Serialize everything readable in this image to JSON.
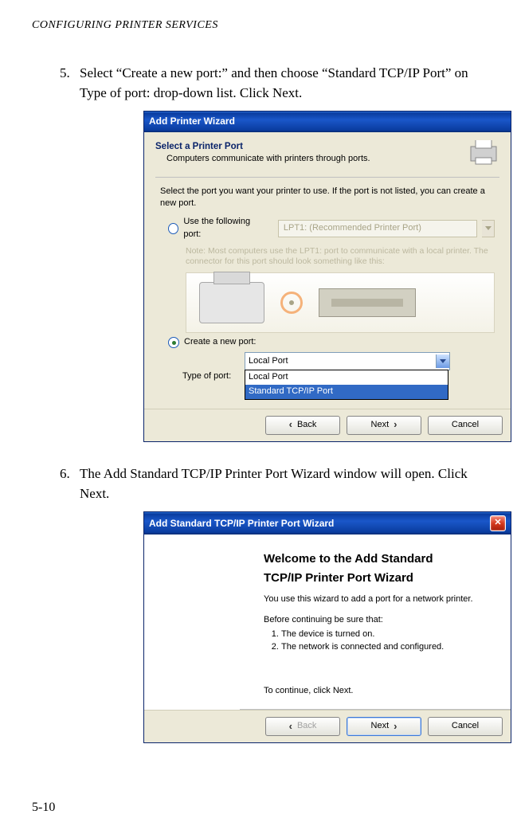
{
  "header": "CONFIGURING PRINTER SERVICES",
  "step5": {
    "num": "5.",
    "text": "Select “Create a new port:” and then choose “Standard TCP/IP Port” on Type of port: drop-down list. Click Next."
  },
  "step6": {
    "num": "6.",
    "text": "The Add Standard TCP/IP Printer Port Wizard window will open. Click Next."
  },
  "win1": {
    "title": "Add Printer Wizard",
    "heading": "Select a Printer Port",
    "desc": "Computers communicate with printers through ports.",
    "instr": "Select the port you want your printer to use.  If the port is not listed, you can create a new port.",
    "radio1": "Use the following port:",
    "lpt1": "LPT1: (Recommended Printer Port)",
    "note": "Note: Most computers use the LPT1: port to communicate with a local printer. The connector for this port should look something like this:",
    "radio2": "Create a new port:",
    "type_label": "Type of port:",
    "combo_selected": "Local Port",
    "combo_options": [
      "Local Port",
      "Standard TCP/IP Port"
    ],
    "back": "Back",
    "next": "Next",
    "cancel": "Cancel"
  },
  "win2": {
    "title": "Add Standard TCP/IP Printer Port Wizard",
    "heading1": "Welcome to the Add Standard",
    "heading2": "TCP/IP Printer Port Wizard",
    "lead": "You use this wizard to add a port for a network printer.",
    "before": "Before continuing be sure that:",
    "req1": "The device is turned on.",
    "req2": "The network is connected and configured.",
    "cont": "To continue, click Next.",
    "back": "Back",
    "next": "Next",
    "cancel": "Cancel"
  },
  "page_number": "5-10"
}
